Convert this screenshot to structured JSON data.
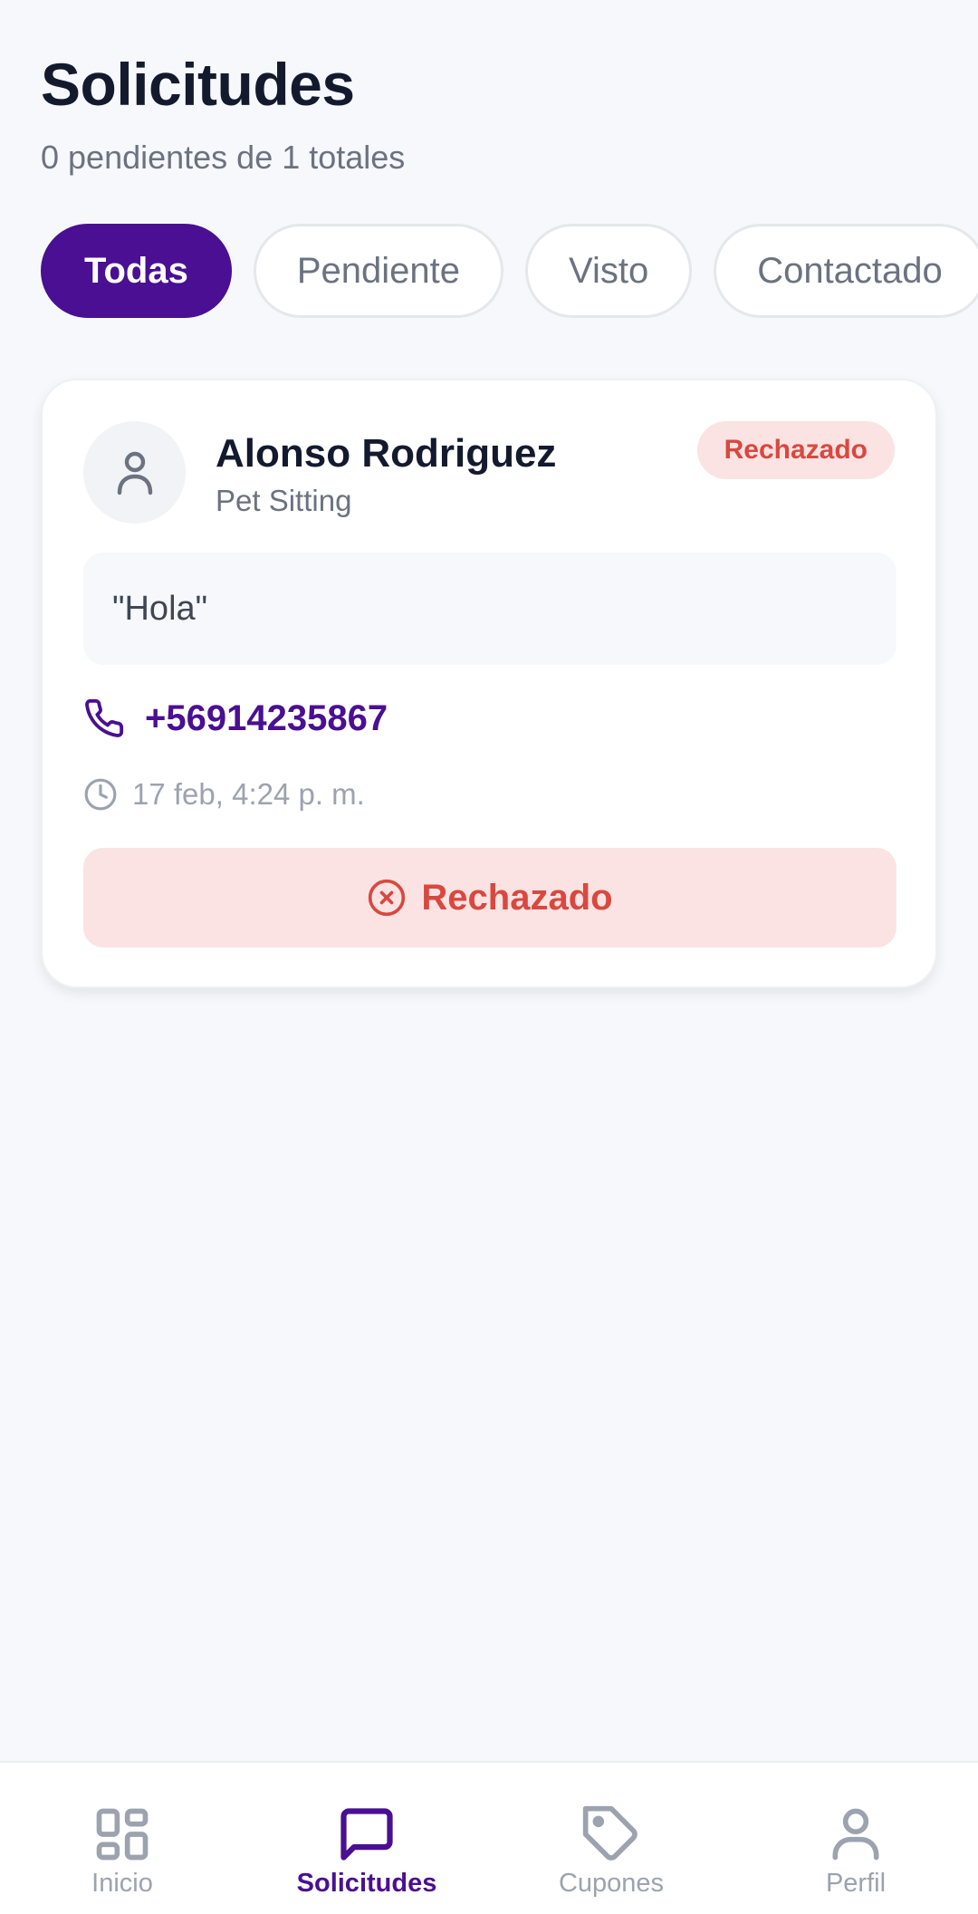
{
  "header": {
    "title": "Solicitudes",
    "subtitle": "0 pendientes de 1 totales"
  },
  "filters": [
    {
      "label": "Todas",
      "active": true
    },
    {
      "label": "Pendiente",
      "active": false
    },
    {
      "label": "Visto",
      "active": false
    },
    {
      "label": "Contactado",
      "active": false
    }
  ],
  "request": {
    "name": "Alonso Rodriguez",
    "service": "Pet Sitting",
    "badge": "Rechazado",
    "message": "\"Hola\"",
    "phone": "+56914235867",
    "timestamp": "17 feb, 4:24 p. m.",
    "status_label": "Rechazado"
  },
  "nav": {
    "items": [
      {
        "label": "Inicio",
        "icon": "grid-icon",
        "active": false
      },
      {
        "label": "Solicitudes",
        "icon": "chat-icon",
        "active": true
      },
      {
        "label": "Cupones",
        "icon": "tag-icon",
        "active": false
      },
      {
        "label": "Perfil",
        "icon": "user-icon",
        "active": false
      }
    ]
  },
  "colors": {
    "primary": "#4a0f92",
    "rejected": "#d9483f",
    "rejected_bg": "#fbe3e3",
    "background": "#f6f8fb"
  }
}
